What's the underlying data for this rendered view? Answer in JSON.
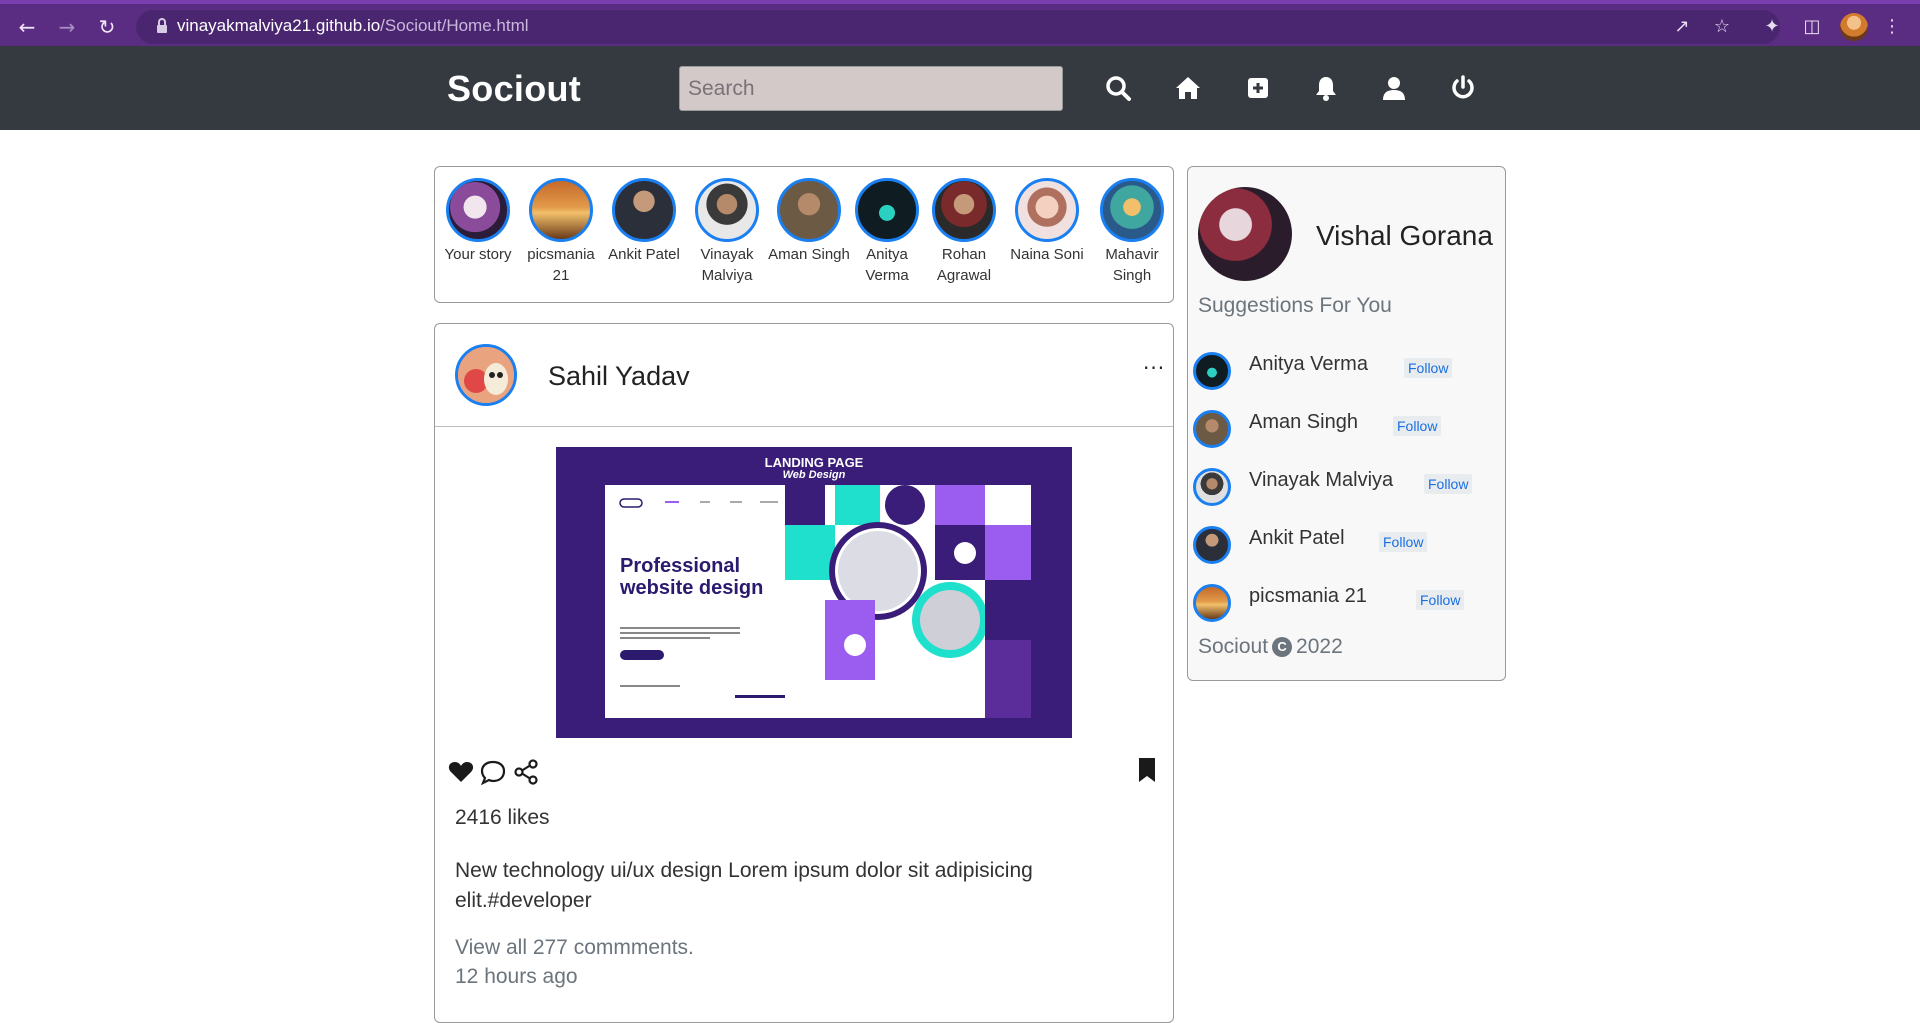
{
  "browser": {
    "url_host": "vinayakmalviya21.github.io",
    "url_path": "/Sociout/Home.html"
  },
  "header": {
    "brand": "Sociout",
    "search_placeholder": "Search",
    "icons": [
      "search-icon",
      "home-icon",
      "add-post-icon",
      "bell-icon",
      "user-icon",
      "power-icon"
    ]
  },
  "stories": [
    {
      "label": "Your story",
      "color": "#5a3a6e"
    },
    {
      "label": "picsmania 21",
      "color": "#d9853a"
    },
    {
      "label": "Ankit Patel",
      "color": "#2b2f3a"
    },
    {
      "label": "Vinayak Malviya",
      "color": "#e5e5e5"
    },
    {
      "label": "Aman Singh",
      "color": "#6d5a45"
    },
    {
      "label": "Anitya Verma",
      "color": "#1d3a3f"
    },
    {
      "label": "Rohan Agrawal",
      "color": "#7a5a44"
    },
    {
      "label": "Naina Soni",
      "color": "#e7b7b0"
    },
    {
      "label": "Mahavir Singh",
      "color": "#3fa6a0"
    }
  ],
  "post": {
    "username": "Sahil Yadav",
    "menu": "···",
    "image": {
      "title": "LANDING PAGE",
      "subtitle": "Web Design",
      "heading": "Professional website design"
    },
    "likes": "2416 likes",
    "caption": "New technology ui/ux design Lorem ipsum dolor sit adipisicing elit.#developer",
    "view_comments": "View all 277 commments.",
    "time_ago": "12 hours ago"
  },
  "sidebar": {
    "profile_name": "Vishal Gorana",
    "suggestions_title": "Suggestions For You",
    "suggestions": [
      {
        "name": "Anitya Verma",
        "follow": "Follow",
        "color": "#1d3a3f"
      },
      {
        "name": "Aman Singh",
        "follow": "Follow",
        "color": "#6d5a45"
      },
      {
        "name": "Vinayak Malviya",
        "follow": "Follow",
        "color": "#cfcfcf"
      },
      {
        "name": "Ankit Patel",
        "follow": "Follow",
        "color": "#2b2f3a"
      },
      {
        "name": "picsmania 21",
        "follow": "Follow",
        "color": "#d9853a"
      }
    ],
    "copyright_brand": "Sociout",
    "copyright_year": "2022"
  }
}
